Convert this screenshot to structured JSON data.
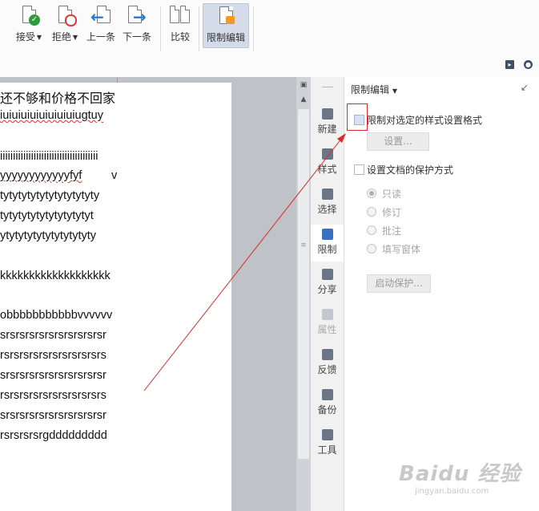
{
  "ribbon": {
    "accept": "接受",
    "reject": "拒绝",
    "prev": "上一条",
    "next": "下一条",
    "compare": "比较",
    "restrict": "限制编辑"
  },
  "document": {
    "lines": [
      "还不够和价格不回家",
      "iuiuiuiuiuiuiuiuiugtuy",
      "iiiiiiiiiiiiiiiiiiiiiiiiiiiiiiiiiiiiii",
      "yyyyyyyyyyyyfyf",
      "v",
      "tytytytytytytytytytyty",
      "tytytytytytytytytytyt",
      "ytytytytytytytytytyty",
      "kkkkkkkkkkkkkkkkkkk",
      "obbbbbbbbbbbvvvvvv",
      "srsrsrsrsrsrsrsrsrsrsr",
      "rsrsrsrsrsrsrsrsrsrsrs",
      "srsrsrsrsrsrsrsrsrsrsr",
      "rsrsrsrsrsrsrsrsrsrsrs",
      "srsrsrsrsrsrsrsrsrsrsr",
      "rsrsrsrsrgddddddddd"
    ]
  },
  "sidetabs": [
    {
      "label": "新建",
      "icon": "new-doc-icon"
    },
    {
      "label": "样式",
      "icon": "style-icon"
    },
    {
      "label": "选择",
      "icon": "select-icon"
    },
    {
      "label": "限制",
      "icon": "restrict-icon"
    },
    {
      "label": "分享",
      "icon": "share-icon"
    },
    {
      "label": "属性",
      "icon": "properties-icon"
    },
    {
      "label": "反馈",
      "icon": "feedback-icon"
    },
    {
      "label": "备份",
      "icon": "backup-icon"
    },
    {
      "label": "工具",
      "icon": "tools-icon"
    }
  ],
  "panel": {
    "title": "限制编辑",
    "restrict_format_label": "限制对选定的样式设置格式",
    "settings_button": "设置...",
    "protection_label": "设置文档的保护方式",
    "options": [
      "只读",
      "修订",
      "批注",
      "填写窗体"
    ],
    "selected_option": "只读",
    "start_button": "启动保护..."
  },
  "watermark": {
    "text": "Baidu 经验",
    "sub": "jingyan.baidu.com"
  },
  "colors": {
    "accent": "#3b6fc4",
    "highlight_box": "#e0282a",
    "arrow": "#e0282a"
  }
}
